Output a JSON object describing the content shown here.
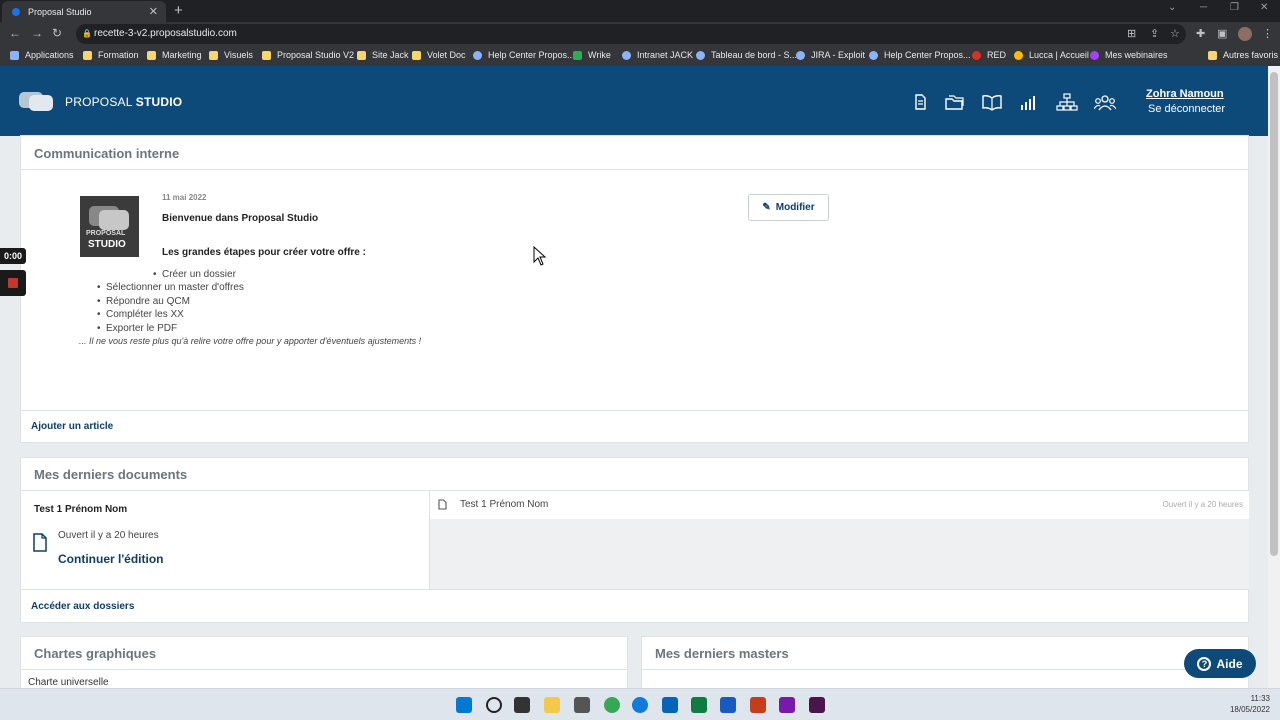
{
  "browser": {
    "tab_title": "Proposal Studio",
    "tab_close": "✕",
    "new_tab": "+",
    "url": "recette-3-v2.proposalstudio.com",
    "bookmarks": [
      {
        "label": "Applications",
        "icon": "grid"
      },
      {
        "label": "Formation",
        "icon": "folder"
      },
      {
        "label": "Marketing",
        "icon": "folder"
      },
      {
        "label": "Visuels",
        "icon": "folder"
      },
      {
        "label": "Proposal Studio V2",
        "icon": "folder"
      },
      {
        "label": "Site Jack",
        "icon": "folder"
      },
      {
        "label": "Volet Doc",
        "icon": "folder"
      },
      {
        "label": "Help Center Propos...",
        "icon": "circle"
      },
      {
        "label": "Wrike",
        "icon": "green"
      },
      {
        "label": "Intranet JACK",
        "icon": "circle"
      },
      {
        "label": "Tableau de bord - S...",
        "icon": "circle"
      },
      {
        "label": "JIRA - Exploit",
        "icon": "circle"
      },
      {
        "label": "Help Center Propos...",
        "icon": "circle"
      },
      {
        "label": "RED",
        "icon": "red"
      },
      {
        "label": "Lucca | Accueil",
        "icon": "yellow"
      },
      {
        "label": "Mes webinaires",
        "icon": "purple"
      },
      {
        "label": "Autres favoris",
        "icon": "folder"
      }
    ]
  },
  "app": {
    "logo_light": "PROPOSAL",
    "logo_bold": "STUDIO",
    "nav_icons": [
      "document-icon",
      "folders-icon",
      "book-icon",
      "stats-icon",
      "org-chart-icon",
      "team-icon"
    ],
    "user_name": "Zohra Namoun",
    "logout": "Se déconnecter",
    "accent": "#0d4a7a"
  },
  "internal_comm": {
    "title": "Communication interne",
    "article": {
      "logo_top": "PROPOSAL",
      "logo_bottom": "STUDIO",
      "date": "11 mai 2022",
      "title": "Bienvenue dans Proposal Studio",
      "subtitle": "Les grandes étapes pour créer votre offre :",
      "steps": [
        "Créer un dossier",
        "Sélectionner un master d'offres",
        "Répondre au QCM",
        "Compléter les XX",
        "Exporter le PDF"
      ],
      "footer": "... Il ne vous reste plus qu'à relire votre offre pour y apporter d'éventuels ajustements !"
    },
    "modify_label": "Modifier",
    "add_article": "Ajouter un article"
  },
  "documents": {
    "title": "Mes derniers documents",
    "featured": {
      "name": "Test 1 Prénom Nom",
      "opened": "Ouvert il y a 20 heures",
      "continue": "Continuer l'édition"
    },
    "list": [
      {
        "name": "Test 1 Prénom Nom",
        "opened": "Ouvert il y a 20 heures"
      }
    ],
    "access_link": "Accéder aux dossiers"
  },
  "charts": {
    "title": "Chartes graphiques",
    "first_item": "Charte universelle"
  },
  "masters": {
    "title": "Mes derniers masters"
  },
  "help_button": "Aide",
  "recorder": {
    "time": "0:00"
  },
  "taskbar": {
    "time": "11:33",
    "date": "18/05/2022"
  }
}
